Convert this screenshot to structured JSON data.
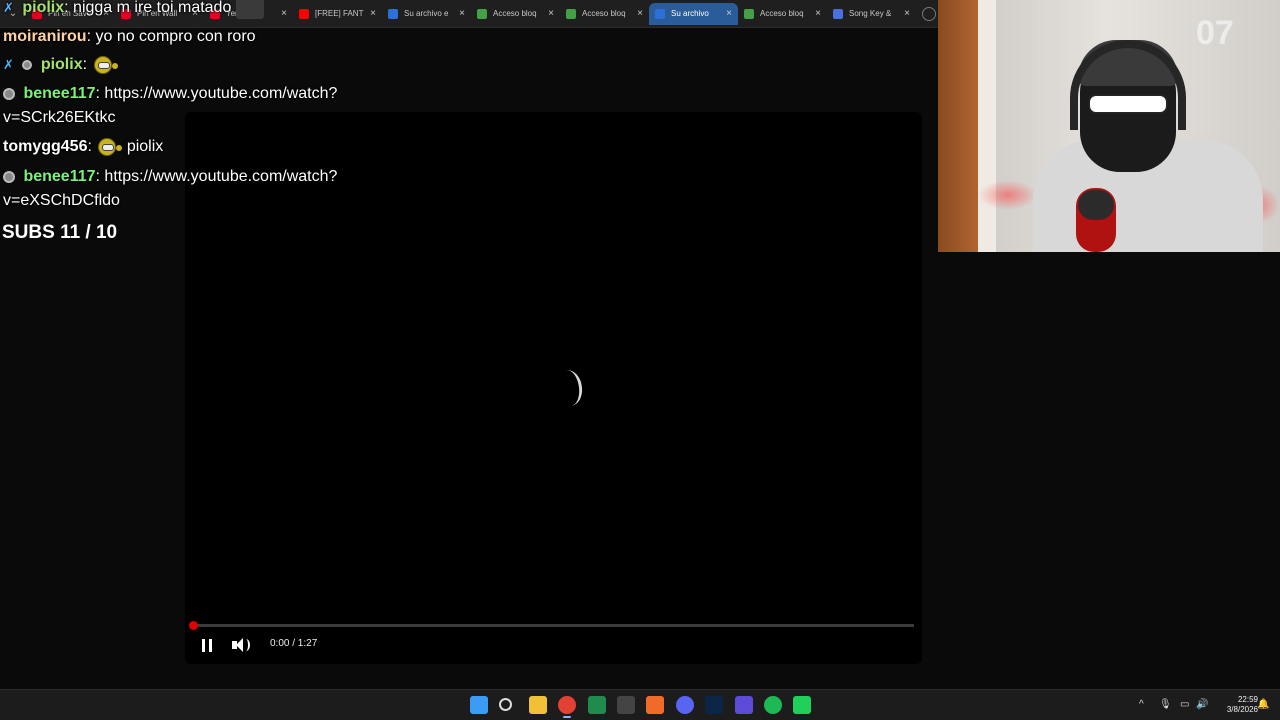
{
  "browser": {
    "tabs": [
      {
        "title": "Pin en Save",
        "favicon_color": "#e60023",
        "active": false
      },
      {
        "title": "Pin en Wall",
        "favicon_color": "#e60023",
        "active": false
      },
      {
        "title": "Yenawarn",
        "favicon_color": "#e60023",
        "active": false
      },
      {
        "title": "[FREE] FANT",
        "favicon_color": "#ff0000",
        "active": false
      },
      {
        "title": "Su archivo e",
        "favicon_color": "#2e6fd9",
        "active": false
      },
      {
        "title": "Acceso bloq",
        "favicon_color": "#43a047",
        "active": false
      },
      {
        "title": "Acceso bloq",
        "favicon_color": "#43a047",
        "active": false
      },
      {
        "title": "Su archivo",
        "favicon_color": "#2e6fd9",
        "active": true
      },
      {
        "title": "Acceso bloq",
        "favicon_color": "#43a047",
        "active": false
      },
      {
        "title": "Song Key &",
        "favicon_color": "#4a6fe0",
        "active": false
      }
    ],
    "tab_close_glyph": "×",
    "menu_glyph": "⌄"
  },
  "chat": {
    "messages": [
      {
        "user": "piolix",
        "user_color": "#a4e36b",
        "text": "nigga m ire toi matado",
        "badge": "sword",
        "emote": "glasses"
      },
      {
        "user": "moiranirou",
        "user_color": "#ffd2a1",
        "text": "yo no compro con roro",
        "badge": "",
        "emote": ""
      },
      {
        "user": "piolix",
        "user_color": "#a4e36b",
        "text": "",
        "badge": "sword",
        "emote": "ball"
      },
      {
        "user": "benee117",
        "user_color": "#7ef07e",
        "text": "https://www.youtube.com/watch?",
        "cont": "v=SCrk26EKtkc",
        "badge": "dot",
        "emote": ""
      },
      {
        "user": "tomygg456",
        "user_color": "#ffffff",
        "text": "piolix",
        "badge": "",
        "emote": "ball"
      },
      {
        "user": "benee117",
        "user_color": "#7ef07e",
        "text": "https://www.youtube.com/watch?",
        "cont": "v=eXSChDCfldo",
        "badge": "dot",
        "emote": ""
      }
    ],
    "separator": ":",
    "subs_goal": "SUBS 11 / 10"
  },
  "player": {
    "time_display": "0:00 / 1:27",
    "progress_fraction": 0.0,
    "state": "loading",
    "accent_color": "#e00000"
  },
  "webcam": {
    "logo_text": "07"
  },
  "taskbar": {
    "icons": [
      {
        "name": "windows-start-icon",
        "color": "#3b9cf5"
      },
      {
        "name": "search-icon",
        "color": "#dddddd"
      },
      {
        "name": "file-explorer-icon",
        "color": "#f2c037"
      },
      {
        "name": "chrome-icon",
        "color": "#e34133",
        "active": true
      },
      {
        "name": "excel-icon",
        "color": "#1f8b4c"
      },
      {
        "name": "obs-icon",
        "color": "#444444"
      },
      {
        "name": "brave-icon",
        "color": "#f06a2a"
      },
      {
        "name": "discord-icon",
        "color": "#5865f2"
      },
      {
        "name": "photoshop-icon",
        "color": "#0a2545"
      },
      {
        "name": "vpn-icon",
        "color": "#5b4bd8"
      },
      {
        "name": "spotify-icon",
        "color": "#1db954"
      },
      {
        "name": "clipchamp-icon",
        "color": "#1fcf5a"
      }
    ],
    "clock_time": "22:59",
    "clock_date": "3/8/2026",
    "tray": {
      "chevron": "^",
      "mic": "🎙",
      "network": "▭",
      "volume": "🔊",
      "bell": "🔔"
    }
  }
}
